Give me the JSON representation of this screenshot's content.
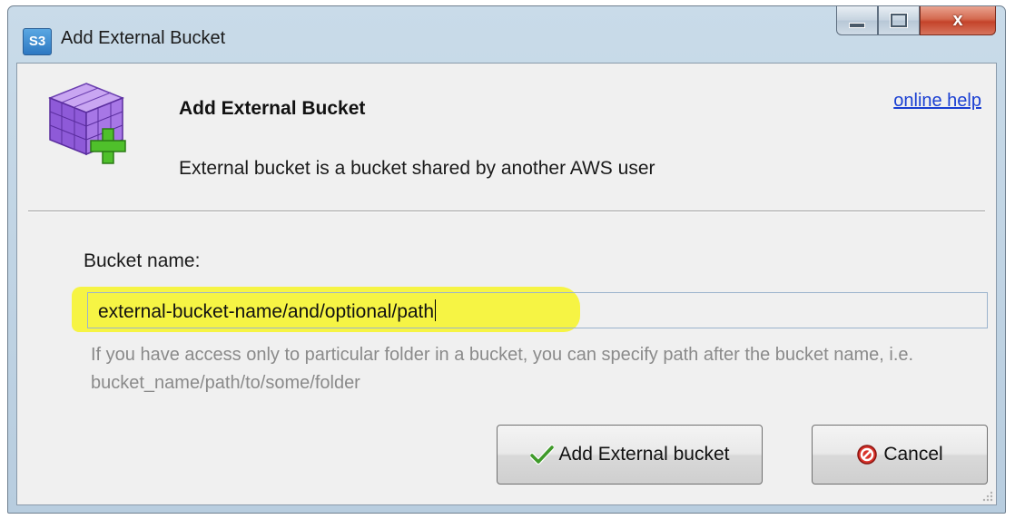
{
  "window": {
    "title": "Add External Bucket",
    "app_icon_text": "S3",
    "controls": {
      "minimize": "minimize-icon",
      "maximize": "maximize-icon",
      "close": "close-icon",
      "close_glyph": "x"
    }
  },
  "header": {
    "icon": "cube-add-icon",
    "title": "Add External Bucket",
    "description": "External bucket is a bucket shared by another  AWS user",
    "help_link": "online help"
  },
  "form": {
    "bucket_label": "Bucket name:",
    "bucket_value": "external-bucket-name/and/optional/path",
    "hint": "If you have access only to particular folder in a bucket, you can specify path after the bucket name, i.e. bucket_name/path/to/some/folder"
  },
  "buttons": {
    "add_label": "Add External bucket",
    "add_icon": "checkmark-icon",
    "cancel_label": "Cancel",
    "cancel_icon": "no-entry-icon"
  },
  "colors": {
    "highlight": "#f6f33a",
    "link": "#1a3fd2",
    "close_button": "#c4432a",
    "titlebar": "#c9dbe9"
  }
}
